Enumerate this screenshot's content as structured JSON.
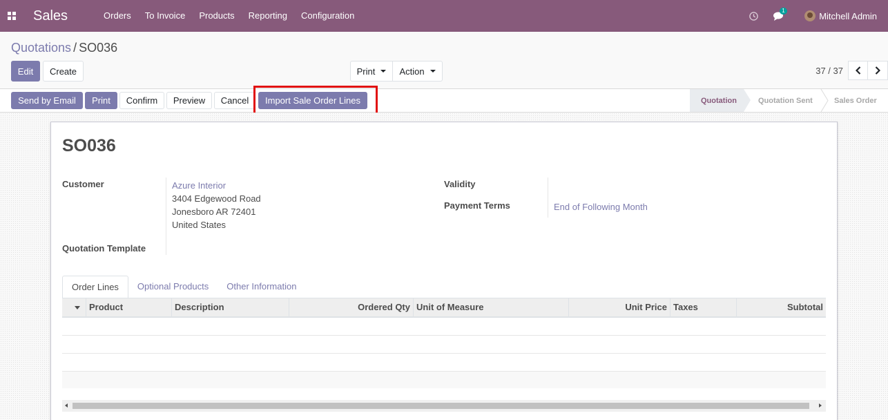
{
  "navbar": {
    "app_name": "Sales",
    "menu": [
      "Orders",
      "To Invoice",
      "Products",
      "Reporting",
      "Configuration"
    ],
    "chat_count": "1",
    "user_name": "Mitchell Admin",
    "bg_color": "#875a7b"
  },
  "breadcrumb": {
    "parent": "Quotations",
    "separator": "/",
    "current": "SO036"
  },
  "control": {
    "edit_label": "Edit",
    "create_label": "Create",
    "print_label": "Print",
    "action_label": "Action",
    "pager": "37 / 37"
  },
  "statusbar": {
    "buttons": {
      "send_email": "Send by Email",
      "print": "Print",
      "confirm": "Confirm",
      "preview": "Preview",
      "cancel": "Cancel",
      "import_lines": "Import Sale Order Lines"
    },
    "stages": [
      "Quotation",
      "Quotation Sent",
      "Sales Order"
    ],
    "active_stage": "Quotation"
  },
  "record": {
    "name": "SO036",
    "customer_label": "Customer",
    "customer_name": "Azure Interior",
    "address_lines": [
      "3404 Edgewood Road",
      "Jonesboro AR 72401",
      "United States"
    ],
    "template_label": "Quotation Template",
    "validity_label": "Validity",
    "payment_terms_label": "Payment Terms",
    "payment_terms_value": "End of Following Month"
  },
  "tabs": [
    "Order Lines",
    "Optional Products",
    "Other Information"
  ],
  "table": {
    "columns": [
      "Product",
      "Description",
      "Ordered Qty",
      "Unit of Measure",
      "Unit Price",
      "Taxes",
      "Subtotal"
    ]
  },
  "colors": {
    "accent": "#7c7bad",
    "highlight": "#e10e0e"
  }
}
